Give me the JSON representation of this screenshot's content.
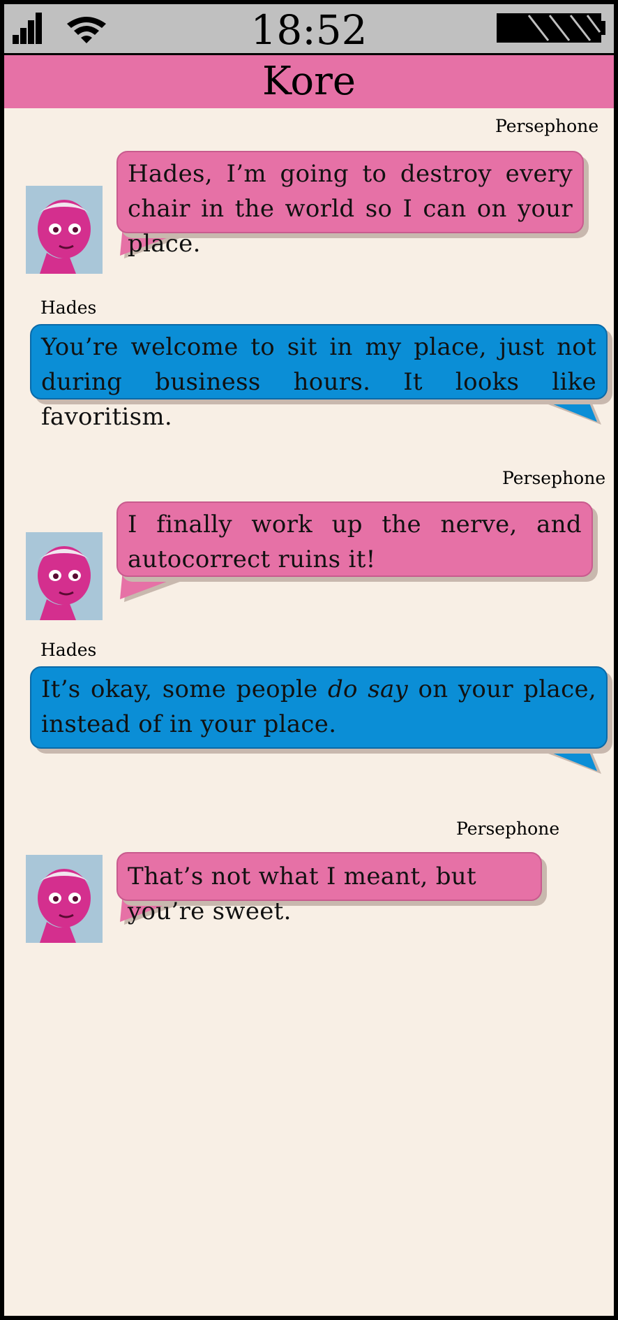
{
  "status_bar": {
    "time": "18:52",
    "signal_icon": "cellular-signal-icon",
    "wifi_icon": "wifi-icon",
    "battery_icon": "battery-icon"
  },
  "header": {
    "title": "Kore"
  },
  "colors": {
    "persephone_bubble": "#e671a6",
    "hades_bubble": "#0b8ed6",
    "background": "#f8efe5",
    "status_bar": "#c0c0c0"
  },
  "messages": [
    {
      "sender": "Persephone",
      "text": "Hades, I’m going to destroy every chair in the world so I can on your place."
    },
    {
      "sender": "Hades",
      "text": "You’re welcome to sit in my place, just not during business hours.  It looks like favoritism."
    },
    {
      "sender": "Persephone",
      "text": "I finally work up the nerve, and autocorrect ruins it!"
    },
    {
      "sender": "Hades",
      "text_before": "It’s okay, some people ",
      "text_em": "do say",
      "text_after": " on your place, instead of in your place."
    },
    {
      "sender": "Persephone",
      "text": "That’s not what I meant, but you’re sweet."
    }
  ]
}
